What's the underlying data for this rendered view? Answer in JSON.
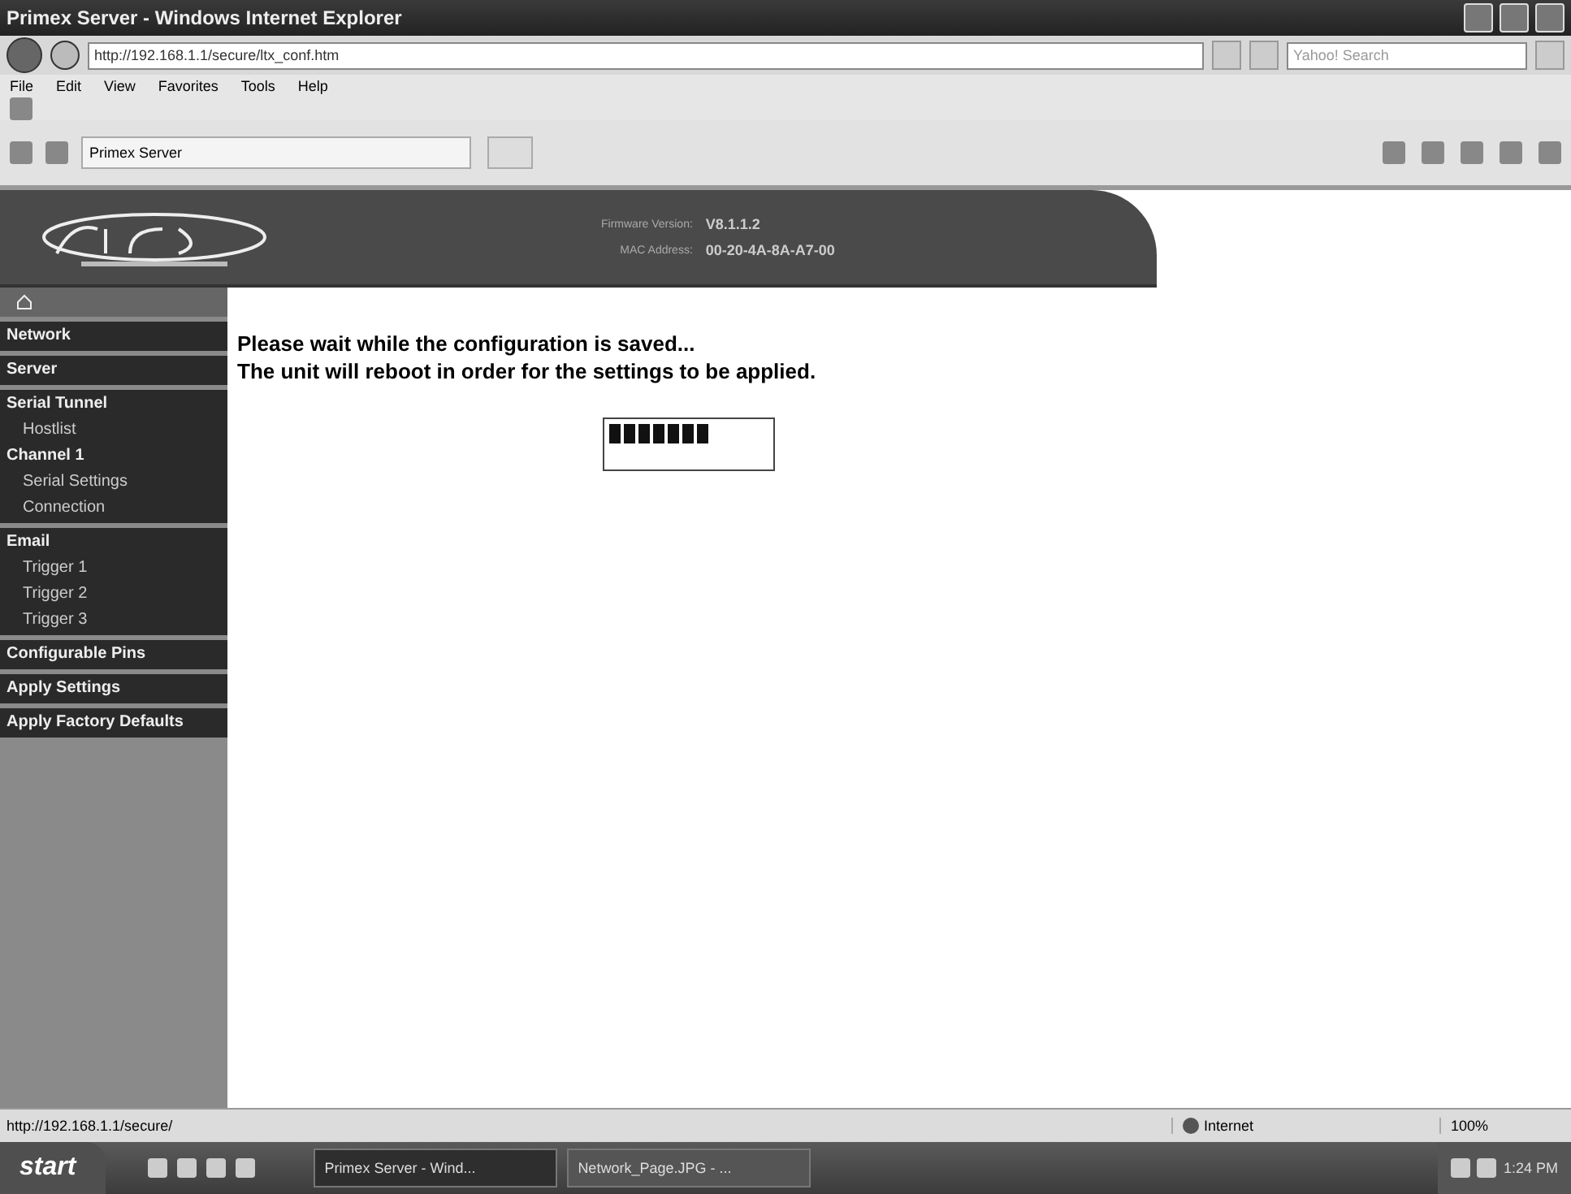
{
  "window": {
    "title": "Primex Server - Windows Internet Explorer"
  },
  "address_bar": {
    "value": "http://192.168.1.1/secure/ltx_conf.htm"
  },
  "search": {
    "placeholder": "Yahoo! Search"
  },
  "menu": [
    "File",
    "Edit",
    "View",
    "Favorites",
    "Tools",
    "Help"
  ],
  "tab": {
    "label": "Primex Server"
  },
  "header": {
    "firmware_label": "Firmware Version:",
    "firmware": "V8.1.1.2",
    "mac_label": "MAC Address:",
    "mac": "00-20-4A-8A-A7-00"
  },
  "sidebar": {
    "groups": [
      [
        {
          "label": "Network"
        }
      ],
      [
        {
          "label": "Server"
        }
      ],
      [
        {
          "label": "Serial Tunnel",
          "children": [
            {
              "label": "Hostlist"
            }
          ]
        },
        {
          "label": "Channel 1",
          "children": [
            {
              "label": "Serial Settings"
            },
            {
              "label": "Connection"
            }
          ]
        }
      ],
      [
        {
          "label": "Email",
          "children": [
            {
              "label": "Trigger 1"
            },
            {
              "label": "Trigger 2"
            },
            {
              "label": "Trigger 3"
            }
          ]
        }
      ],
      [
        {
          "label": "Configurable Pins"
        }
      ],
      [
        {
          "label": "Apply Settings"
        }
      ],
      [
        {
          "label": "Apply Factory Defaults"
        }
      ]
    ]
  },
  "message": [
    "Please wait while the configuration is saved...",
    "The unit will reboot in order for the settings to be applied."
  ],
  "progress": {
    "kind": "blocks"
  },
  "status_bar": {
    "url": "http://192.168.1.1/secure/",
    "zone": "Internet",
    "zoom": "100%"
  },
  "taskbar": {
    "start": "start",
    "tasks": [
      {
        "label": "Primex Server - Wind...",
        "selected": true
      },
      {
        "label": "Network_Page.JPG - ...",
        "selected": false
      }
    ],
    "clock": "1:24 PM"
  }
}
